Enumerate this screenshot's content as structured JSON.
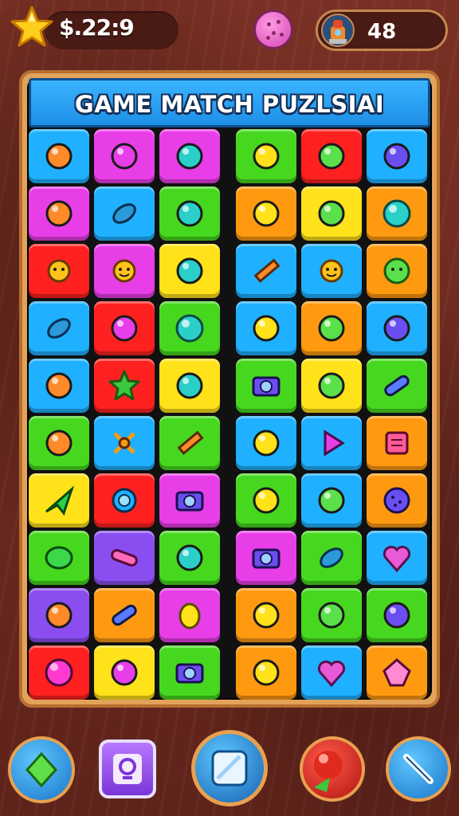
{
  "hud": {
    "coins": "$.22:9",
    "score": "48",
    "star_icon": "star-icon",
    "cookie_icon": "cookie-icon",
    "avatar_icon": "robot-avatar-icon"
  },
  "title": "GAME MATCH PUZLSIAI",
  "tiles": [
    [
      "#1fb0ff",
      "sun-monster-icon"
    ],
    [
      "#e83ee8",
      "swirl-icon"
    ],
    [
      "#e83ee8",
      "bag-icon"
    ],
    [
      "#46d81e",
      "candy-icon"
    ],
    [
      "#ff2020",
      "kettle-icon"
    ],
    [
      "#1fb0ff",
      "bubbles-icon"
    ],
    [
      "#e83ee8",
      "fuzzy-monster-icon"
    ],
    [
      "#1fb0ff",
      "leaf-icon"
    ],
    [
      "#46d81e",
      "bird-icon"
    ],
    [
      "#ff9a10",
      "chat-icon"
    ],
    [
      "#ffe21a",
      "bag-icon"
    ],
    [
      "#ff9a10",
      "orb-icon"
    ],
    [
      "#ff2020",
      "sun-icon"
    ],
    [
      "#e83ee8",
      "sun-face-icon"
    ],
    [
      "#ffe21a",
      "phone-icon"
    ],
    [
      "#1fb0ff",
      "pencil-icon"
    ],
    [
      "#1fb0ff",
      "sun-face-icon"
    ],
    [
      "#ff9a10",
      "slime-icon"
    ],
    [
      "#1fb0ff",
      "leaf-icon"
    ],
    [
      "#ff2020",
      "house-icon"
    ],
    [
      "#46d81e",
      "orb-icon"
    ],
    [
      "#1fb0ff",
      "flower-icon"
    ],
    [
      "#ff9a10",
      "palette-icon"
    ],
    [
      "#1fb0ff",
      "stack-icon"
    ],
    [
      "#1fb0ff",
      "arrow-icon"
    ],
    [
      "#ff2020",
      "star-icon"
    ],
    [
      "#ffe21a",
      "map-icon"
    ],
    [
      "#46d81e",
      "camera-icon"
    ],
    [
      "#ffe21a",
      "pen-icon"
    ],
    [
      "#46d81e",
      "capsule-icon"
    ],
    [
      "#46d81e",
      "crayon-icon"
    ],
    [
      "#1fb0ff",
      "cross-icon"
    ],
    [
      "#46d81e",
      "pencil-icon"
    ],
    [
      "#1fb0ff",
      "plus-box-icon"
    ],
    [
      "#1fb0ff",
      "play-icon"
    ],
    [
      "#ff9a10",
      "cube-icon"
    ],
    [
      "#ffe21a",
      "paper-plane-icon"
    ],
    [
      "#ff2020",
      "ring-icon"
    ],
    [
      "#e83ee8",
      "camera-icon"
    ],
    [
      "#46d81e",
      "cards-icon"
    ],
    [
      "#1fb0ff",
      "ice-cream-icon"
    ],
    [
      "#ff9a10",
      "cookie-icon"
    ],
    [
      "#46d81e",
      "blob-icon"
    ],
    [
      "#8a4ef0",
      "sausage-icon"
    ],
    [
      "#46d81e",
      "bow-icon"
    ],
    [
      "#e83ee8",
      "camera-icon"
    ],
    [
      "#46d81e",
      "leaf-icon"
    ],
    [
      "#1fb0ff",
      "heart-icon"
    ],
    [
      "#8a4ef0",
      "splat-icon"
    ],
    [
      "#ff9a10",
      "capsule-icon"
    ],
    [
      "#e83ee8",
      "egg-icon"
    ],
    [
      "#ff9a10",
      "radio-icon"
    ],
    [
      "#46d81e",
      "ice-cream-icon"
    ],
    [
      "#46d81e",
      "calendar-icon"
    ],
    [
      "#ff2020",
      "ball-icon"
    ],
    [
      "#ffe21a",
      "brush-icon"
    ],
    [
      "#46d81e",
      "camera-icon"
    ],
    [
      "#ff9a10",
      "brush-icon"
    ],
    [
      "#1fb0ff",
      "heart-icon"
    ],
    [
      "#ff9a10",
      "gem-icon"
    ]
  ],
  "bottom": {
    "buttons": [
      "diamond-icon",
      "search-icon",
      "square-icon",
      "bomb-icon",
      "slash-icon"
    ]
  }
}
